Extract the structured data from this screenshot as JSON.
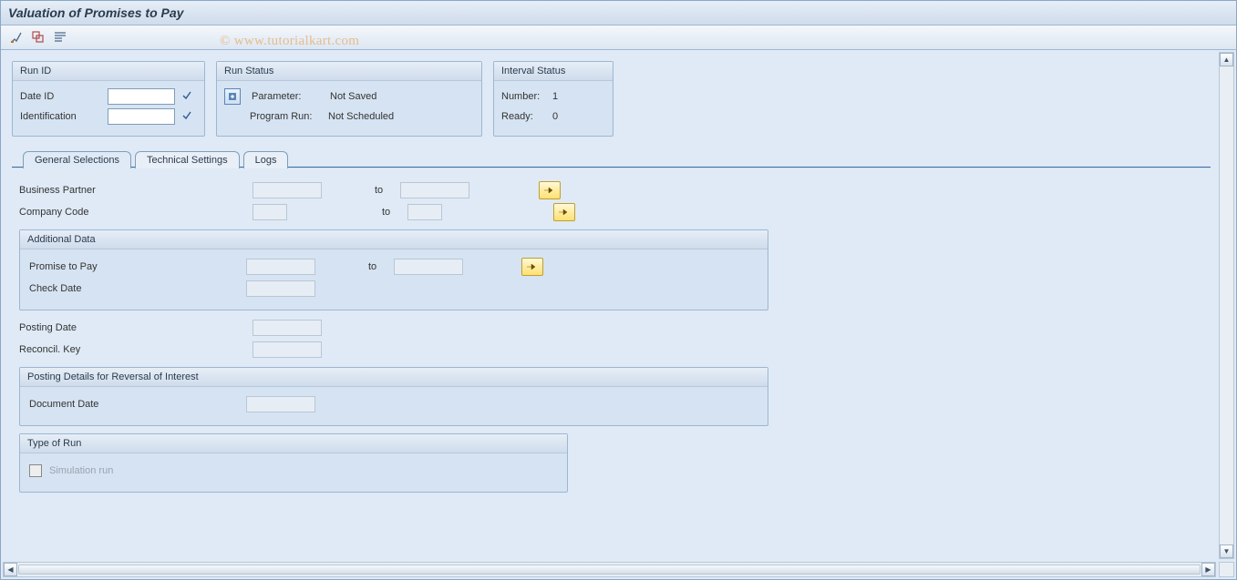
{
  "title": "Valuation of Promises to Pay",
  "watermark": "© www.tutorialkart.com",
  "toolbar": {
    "btn1_name": "tool-icon-1",
    "btn2_name": "tool-icon-2",
    "btn3_name": "tool-icon-3"
  },
  "panels": {
    "run_id": {
      "title": "Run ID",
      "date_id_label": "Date ID",
      "identification_label": "Identification",
      "date_id_value": "",
      "identification_value": ""
    },
    "run_status": {
      "title": "Run Status",
      "parameter_label": "Parameter:",
      "parameter_value": "Not Saved",
      "program_run_label": "Program Run:",
      "program_run_value": "Not Scheduled"
    },
    "interval_status": {
      "title": "Interval Status",
      "number_label": "Number:",
      "number_value": "1",
      "ready_label": "Ready:",
      "ready_value": "0"
    }
  },
  "tabs": {
    "general": "General Selections",
    "technical": "Technical Settings",
    "logs": "Logs"
  },
  "general_tab": {
    "business_partner_label": "Business Partner",
    "company_code_label": "Company Code",
    "to_label": "to",
    "additional_data_title": "Additional Data",
    "promise_to_pay_label": "Promise to Pay",
    "check_date_label": "Check Date",
    "posting_date_label": "Posting Date",
    "reconcil_key_label": "Reconcil. Key",
    "posting_details_title": "Posting Details for Reversal of Interest",
    "document_date_label": "Document Date",
    "type_of_run_title": "Type of Run",
    "simulation_run_label": "Simulation run",
    "fields": {
      "business_partner_from": "",
      "business_partner_to": "",
      "company_code_from": "",
      "company_code_to": "",
      "promise_to_pay_from": "",
      "promise_to_pay_to": "",
      "check_date": "",
      "posting_date": "",
      "reconcil_key": "",
      "document_date": ""
    },
    "simulation_run_checked": false
  }
}
